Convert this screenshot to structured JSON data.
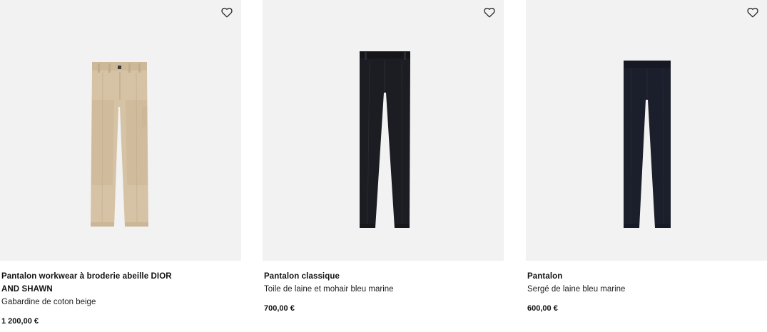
{
  "products": [
    {
      "title": "Pantalon workwear à broderie abeille DIOR AND SHAWN",
      "material": "Gabardine de coton beige",
      "price": "1 200,00 €",
      "color": "#d6c3a5",
      "wishlist_icon": "heart-outline-icon"
    },
    {
      "title": "Pantalon classique",
      "material": "Toile de laine et mohair bleu marine",
      "price": "700,00 €",
      "color": "#1c1d22",
      "wishlist_icon": "heart-outline-icon"
    },
    {
      "title": "Pantalon",
      "material": "Sergé de laine bleu marine",
      "price": "600,00 €",
      "color": "#1b1e2b",
      "wishlist_icon": "heart-outline-icon"
    }
  ]
}
